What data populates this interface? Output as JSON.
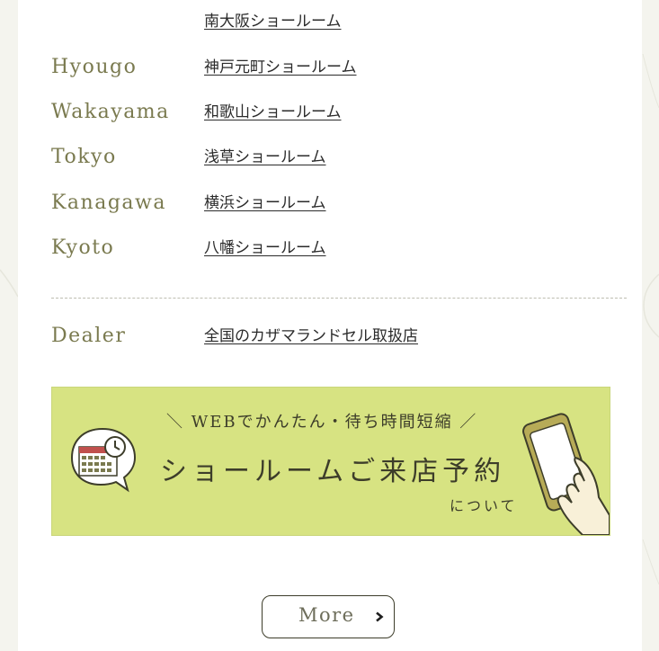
{
  "showrooms": [
    {
      "region": "",
      "link": "南大阪ショールーム"
    },
    {
      "region": "Hyougo",
      "link": "神戸元町ショールーム"
    },
    {
      "region": "Wakayama",
      "link": "和歌山ショールーム"
    },
    {
      "region": "Tokyo",
      "link": "浅草ショールーム"
    },
    {
      "region": "Kanagawa",
      "link": "横浜ショールーム"
    },
    {
      "region": "Kyoto",
      "link": "八幡ショールーム"
    }
  ],
  "dealer": {
    "region": "Dealer",
    "link": "全国のカザマランドセル取扱店"
  },
  "banner": {
    "subtitle": "＼ WEBでかんたん・待ち時間短縮 ／",
    "title": "ショールームご来店予約",
    "note": "について",
    "icons": [
      "calendar-clock-icon",
      "smartphone-hand-icon"
    ]
  },
  "more_button": {
    "label": "More",
    "icon": "chevron-right-icon"
  },
  "colors": {
    "page_bg": "#f4f4ee",
    "card_bg": "#ffffff",
    "region_text": "#7a7a4f",
    "banner_bg": "#d7e382",
    "banner_text": "#3d3d2a"
  }
}
